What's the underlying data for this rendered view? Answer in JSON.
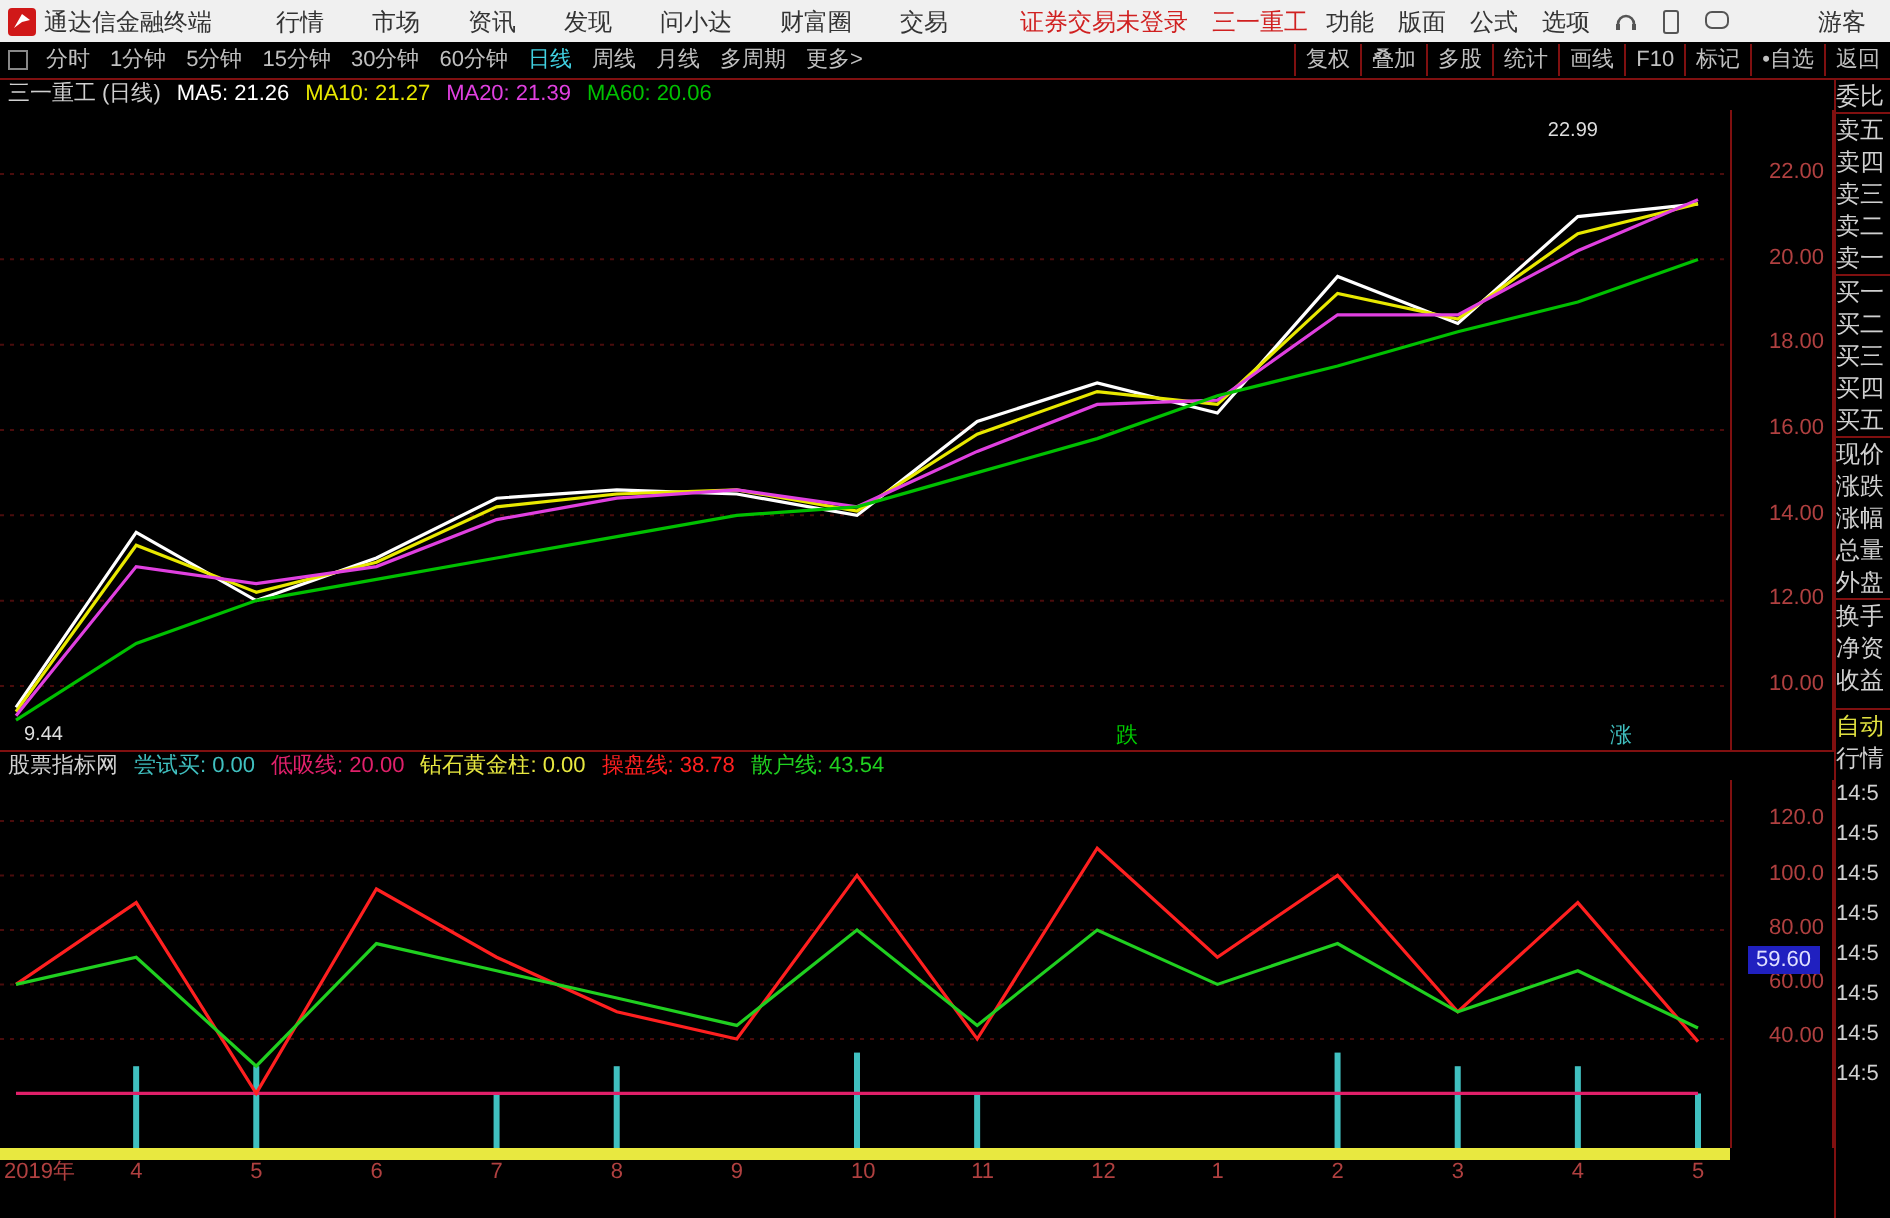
{
  "app": {
    "title": "通达信金融终端",
    "menu": [
      "行情",
      "市场",
      "资讯",
      "发现",
      "问小达",
      "财富圈",
      "交易"
    ],
    "status": "证券交易未登录",
    "stock": "三一重工",
    "tools": [
      "功能",
      "版面",
      "公式",
      "选项"
    ],
    "user": "游客"
  },
  "periods": [
    {
      "label": "分时",
      "selected": false
    },
    {
      "label": "1分钟",
      "selected": false
    },
    {
      "label": "5分钟",
      "selected": false
    },
    {
      "label": "15分钟",
      "selected": false
    },
    {
      "label": "30分钟",
      "selected": false
    },
    {
      "label": "60分钟",
      "selected": false
    },
    {
      "label": "日线",
      "selected": true
    },
    {
      "label": "周线",
      "selected": false
    },
    {
      "label": "月线",
      "selected": false
    },
    {
      "label": "多周期",
      "selected": false
    },
    {
      "label": "更多>",
      "selected": false
    }
  ],
  "actions": [
    "复权",
    "叠加",
    "多股",
    "统计",
    "画线",
    "F10",
    "标记",
    "•自选",
    "返回"
  ],
  "price_chart": {
    "title": "三一重工 (日线)",
    "legend_values": [
      "21.26",
      "21.27",
      "21.39",
      "20.06"
    ],
    "high_label": "22.99",
    "low_label": "9.44",
    "markers": [
      {
        "text": "跌",
        "color": "#00cc00"
      },
      {
        "text": "涨",
        "color": "#40c0c0"
      }
    ],
    "chart_data": {
      "type": "line",
      "grid": true,
      "ylim": [
        8.5,
        23.5
      ],
      "yticks": [
        {
          "value": 10,
          "label": "10.00"
        },
        {
          "value": 12,
          "label": "12.00"
        },
        {
          "value": 14,
          "label": "14.00"
        },
        {
          "value": 16,
          "label": "16.00"
        },
        {
          "value": 18,
          "label": "18.00"
        },
        {
          "value": 20,
          "label": "20.00"
        },
        {
          "value": 22,
          "label": "22.00"
        }
      ],
      "series": [
        {
          "name": "MA5:",
          "color": "#ffffff",
          "values": [
            9.5,
            13.6,
            12.0,
            13.0,
            14.4,
            14.6,
            14.5,
            14.0,
            16.2,
            17.1,
            16.4,
            19.6,
            18.5,
            21.0,
            21.3
          ]
        },
        {
          "name": "MA10:",
          "color": "#e8e800",
          "values": [
            9.4,
            13.3,
            12.2,
            12.9,
            14.2,
            14.5,
            14.6,
            14.1,
            15.9,
            16.9,
            16.6,
            19.2,
            18.6,
            20.6,
            21.3
          ]
        },
        {
          "name": "MA20:",
          "color": "#e040e0",
          "values": [
            9.3,
            12.8,
            12.4,
            12.8,
            13.9,
            14.4,
            14.6,
            14.2,
            15.5,
            16.6,
            16.7,
            18.7,
            18.7,
            20.2,
            21.4
          ]
        },
        {
          "name": "MA60:",
          "color": "#00c000",
          "values": [
            9.2,
            11.0,
            12.0,
            12.5,
            13.0,
            13.5,
            14.0,
            14.2,
            15.0,
            15.8,
            16.8,
            17.5,
            18.3,
            19.0,
            20.0
          ]
        }
      ]
    }
  },
  "indicator_chart": {
    "title": "股票指标网",
    "extra_legend": [
      {
        "name": "钻石黄金柱:",
        "value": "0.00",
        "color": "#e8e840"
      }
    ],
    "legend_values": [
      "0.00",
      "20.00",
      "38.78",
      "43.54"
    ],
    "current_value": "59.60",
    "chart_data": {
      "type": "line",
      "grid": true,
      "categories": [
        "2019年",
        "4",
        "5",
        "6",
        "7",
        "8",
        "9",
        "10",
        "11",
        "12",
        "1",
        "2",
        "3",
        "4",
        "5"
      ],
      "ylim": [
        0,
        135
      ],
      "yticks": [
        {
          "value": 40,
          "label": "40.00"
        },
        {
          "value": 60,
          "label": "60.00"
        },
        {
          "value": 80,
          "label": "80.00"
        },
        {
          "value": 100,
          "label": "100.0"
        },
        {
          "value": 120,
          "label": "120.0"
        }
      ],
      "series": [
        {
          "name": "尝试买:",
          "type": "bar",
          "color": "#40c0c0",
          "values": [
            null,
            30,
            30,
            null,
            20,
            30,
            null,
            35,
            20,
            null,
            null,
            35,
            30,
            30,
            20
          ]
        },
        {
          "name": "低吸线:",
          "color": "#e0206a",
          "values": [
            20,
            20,
            20,
            20,
            20,
            20,
            20,
            20,
            20,
            20,
            20,
            20,
            20,
            20,
            20
          ]
        },
        {
          "name": "操盘线:",
          "color": "#ff2020",
          "values": [
            60,
            90,
            20,
            95,
            70,
            50,
            40,
            100,
            40,
            110,
            70,
            100,
            50,
            90,
            39
          ]
        },
        {
          "name": "散户线:",
          "color": "#20d020",
          "values": [
            60,
            70,
            30,
            75,
            65,
            55,
            45,
            80,
            45,
            80,
            60,
            75,
            50,
            65,
            44
          ]
        }
      ]
    }
  },
  "quote_panel": {
    "labels": [
      "委比",
      "卖五",
      "卖四",
      "卖三",
      "卖二",
      "卖一",
      "买一",
      "买二",
      "买三",
      "买四",
      "买五",
      "现价",
      "涨跌",
      "涨幅",
      "总量",
      "外盘",
      "换手",
      "净资",
      "收益"
    ],
    "mode": "自动",
    "mode_sub": "行情",
    "times": [
      "14:5",
      "14:5",
      "14:5",
      "14:5",
      "14:5",
      "14:5",
      "14:5",
      "14:5"
    ]
  }
}
